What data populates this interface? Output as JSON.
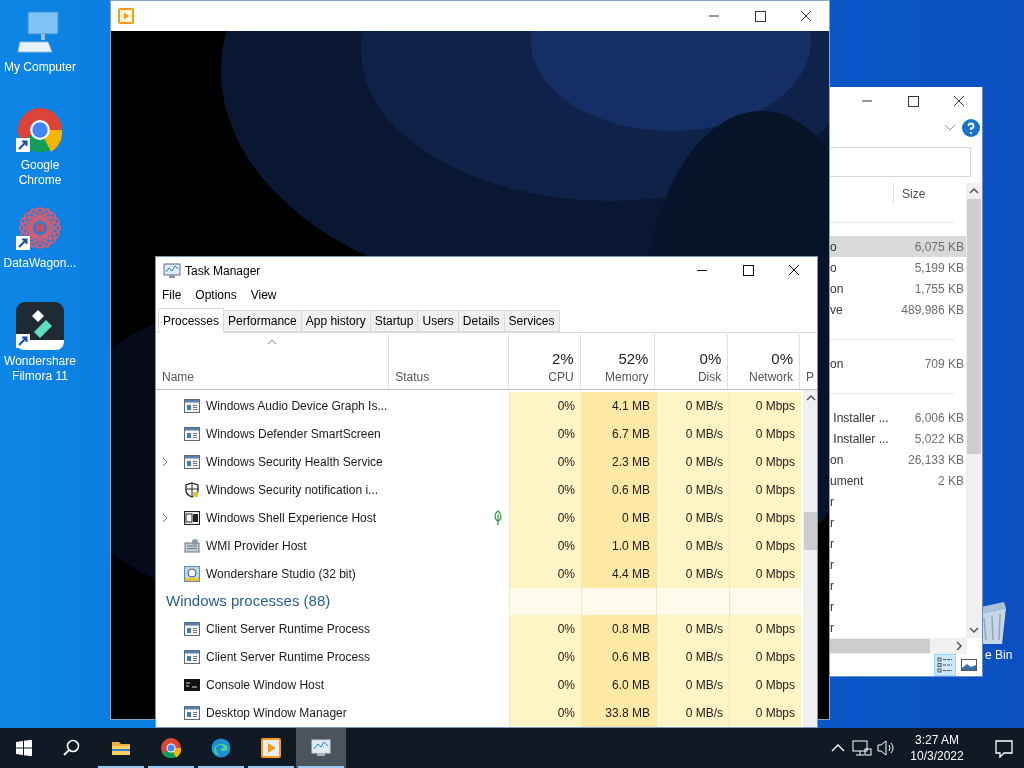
{
  "desktop": {
    "icons": [
      {
        "kind": "computer",
        "label": "My Computer",
        "shortcut": false
      },
      {
        "kind": "chrome",
        "label": "Google Chrome",
        "shortcut": true
      },
      {
        "kind": "datawagon",
        "label": "DataWagon...",
        "shortcut": true
      },
      {
        "kind": "filmora",
        "label": "Wondershare Filmora 11",
        "shortcut": true
      }
    ],
    "recycle_bin": {
      "label": "e Bin"
    }
  },
  "explorer": {
    "column": "Size",
    "groups": [
      {
        "rows": [
          {
            "name": "o",
            "size": "6,075 KB",
            "selected": true
          },
          {
            "name": "o",
            "size": "5,199 KB",
            "selected": false
          },
          {
            "name": "on",
            "size": "1,755 KB",
            "selected": false
          },
          {
            "name": "ve",
            "size": "489,986 KB",
            "selected": false
          }
        ]
      },
      {
        "rows": [
          {
            "name": "on",
            "size": "709 KB",
            "selected": false
          }
        ]
      },
      {
        "rows": [
          {
            "name": " Installer ...",
            "size": "6,006 KB",
            "selected": false
          },
          {
            "name": " Installer ...",
            "size": "5,022 KB",
            "selected": false
          },
          {
            "name": "on",
            "size": "26,133 KB",
            "selected": false
          },
          {
            "name": "ument",
            "size": "2 KB",
            "selected": false
          },
          {
            "name": "r",
            "selected": false
          },
          {
            "name": "r",
            "selected": false
          },
          {
            "name": "r",
            "selected": false
          },
          {
            "name": "r",
            "selected": false
          },
          {
            "name": "r",
            "selected": false
          },
          {
            "name": "r",
            "selected": false
          },
          {
            "name": "r",
            "selected": false
          }
        ]
      }
    ],
    "views": [
      {
        "kind": "details",
        "selected": true
      },
      {
        "kind": "preview",
        "selected": false
      }
    ]
  },
  "task_manager": {
    "title": "Task Manager",
    "menu": [
      "File",
      "Options",
      "View"
    ],
    "tabs": [
      {
        "label": "Processes",
        "selected": true
      },
      {
        "label": "Performance",
        "selected": false
      },
      {
        "label": "App history",
        "selected": false
      },
      {
        "label": "Startup",
        "selected": false
      },
      {
        "label": "Users",
        "selected": false
      },
      {
        "label": "Details",
        "selected": false
      },
      {
        "label": "Services",
        "selected": false
      }
    ],
    "columns": [
      {
        "label": "Name",
        "sorted": true
      },
      {
        "label": "Status",
        "sorted": false
      },
      {
        "total": "2%",
        "label": "CPU",
        "sorted": false
      },
      {
        "total": "52%",
        "label": "Memory",
        "sorted": false
      },
      {
        "total": "0%",
        "label": "Disk",
        "sorted": false
      },
      {
        "total": "0%",
        "label": "Network",
        "sorted": false
      },
      {
        "label": "P",
        "sorted": false
      }
    ],
    "rows": [
      {
        "kind": "window",
        "name": "Windows Audio Device Graph Is...",
        "expandable": false,
        "suspended": false,
        "cpu": "0%",
        "memory": "4.1 MB",
        "disk": "0 MB/s",
        "network": "0 Mbps"
      },
      {
        "kind": "window",
        "name": "Windows Defender SmartScreen",
        "expandable": false,
        "suspended": false,
        "cpu": "0%",
        "memory": "6.7 MB",
        "disk": "0 MB/s",
        "network": "0 Mbps"
      },
      {
        "kind": "window",
        "name": "Windows Security Health Service",
        "expandable": true,
        "suspended": false,
        "cpu": "0%",
        "memory": "2.3 MB",
        "disk": "0 MB/s",
        "network": "0 Mbps"
      },
      {
        "kind": "shield",
        "name": "Windows Security notification i...",
        "expandable": false,
        "suspended": false,
        "cpu": "0%",
        "memory": "0.6 MB",
        "disk": "0 MB/s",
        "network": "0 Mbps"
      },
      {
        "kind": "shell",
        "name": "Windows Shell Experience Host",
        "expandable": true,
        "suspended": true,
        "cpu": "0%",
        "memory": "0 MB",
        "disk": "0 MB/s",
        "network": "0 Mbps"
      },
      {
        "kind": "wmi",
        "name": "WMI Provider Host",
        "expandable": false,
        "suspended": false,
        "cpu": "0%",
        "memory": "1.0 MB",
        "disk": "0 MB/s",
        "network": "0 Mbps"
      },
      {
        "kind": "studio",
        "name": "Wondershare Studio (32 bit)",
        "expandable": false,
        "suspended": false,
        "cpu": "0%",
        "memory": "4.4 MB",
        "disk": "0 MB/s",
        "network": "0 Mbps"
      },
      {
        "kind": "group",
        "name": "Windows processes (88)"
      },
      {
        "kind": "window",
        "name": "Client Server Runtime Process",
        "expandable": false,
        "suspended": false,
        "cpu": "0%",
        "memory": "0.8 MB",
        "disk": "0 MB/s",
        "network": "0 Mbps"
      },
      {
        "kind": "window",
        "name": "Client Server Runtime Process",
        "expandable": false,
        "suspended": false,
        "cpu": "0%",
        "memory": "0.6 MB",
        "disk": "0 MB/s",
        "network": "0 Mbps"
      },
      {
        "kind": "console",
        "name": "Console Window Host",
        "expandable": false,
        "suspended": false,
        "cpu": "0%",
        "memory": "6.0 MB",
        "disk": "0 MB/s",
        "network": "0 Mbps"
      },
      {
        "kind": "window",
        "name": "Desktop Window Manager",
        "expandable": false,
        "suspended": false,
        "cpu": "0%",
        "memory": "33.8 MB",
        "disk": "0 MB/s",
        "network": "0 Mbps"
      }
    ]
  },
  "taskbar": {
    "apps": [
      {
        "kind": "start",
        "running": false,
        "active": false
      },
      {
        "kind": "search",
        "running": false,
        "active": false
      },
      {
        "kind": "folder",
        "running": true,
        "active": false
      },
      {
        "kind": "chrome",
        "running": true,
        "active": false
      },
      {
        "kind": "edge",
        "running": true,
        "active": false
      },
      {
        "kind": "player",
        "running": true,
        "active": false
      },
      {
        "kind": "monitor",
        "running": true,
        "active": true
      }
    ],
    "clock": {
      "time": "3:27 AM",
      "date": "10/3/2022"
    }
  }
}
